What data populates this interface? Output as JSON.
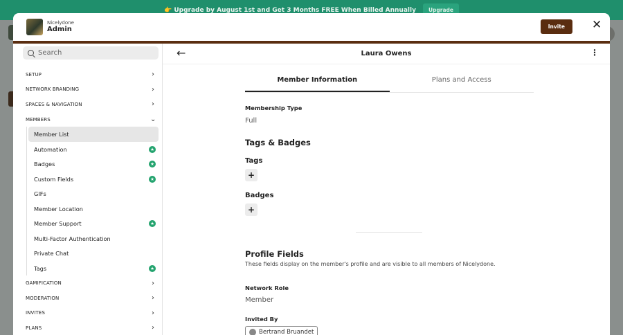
{
  "banner": {
    "text": "👉 Upgrade by August 1st and Get 3 Months FREE When Billed Annually",
    "button": "Upgrade"
  },
  "modal": {
    "org_name": "Nicelydone",
    "role": "Admin",
    "invite_label": "Invite",
    "close_icon": "close-icon"
  },
  "sidebar": {
    "search_placeholder": "Search",
    "sections_top": [
      {
        "label": "SETUP"
      },
      {
        "label": "NETWORK BRANDING"
      },
      {
        "label": "SPACES & NAVIGATION"
      }
    ],
    "members_label": "MEMBERS",
    "members_items": [
      {
        "label": "Member List",
        "badge": false,
        "active": true
      },
      {
        "label": "Automation",
        "badge": true
      },
      {
        "label": "Badges",
        "badge": true
      },
      {
        "label": "Custom Fields",
        "badge": true
      },
      {
        "label": "GIFs",
        "badge": false
      },
      {
        "label": "Member Location",
        "badge": false
      },
      {
        "label": "Member Support",
        "badge": true
      },
      {
        "label": "Multi-Factor Authentication",
        "badge": false
      },
      {
        "label": "Private Chat",
        "badge": false
      },
      {
        "label": "Tags",
        "badge": true
      }
    ],
    "sections_bottom": [
      {
        "label": "GAMIFICATION"
      },
      {
        "label": "MODERATION"
      },
      {
        "label": "INVITES"
      },
      {
        "label": "PLANS"
      }
    ]
  },
  "member": {
    "name": "Laura Owens",
    "tabs": [
      {
        "label": "Member Information",
        "active": true
      },
      {
        "label": "Plans and Access",
        "active": false
      }
    ],
    "membership_type_label": "Membership Type",
    "membership_type": "Full",
    "tags_badges_heading": "Tags & Badges",
    "tags_label": "Tags",
    "badges_label": "Badges",
    "add_symbol": "+",
    "profile_fields_heading": "Profile Fields",
    "profile_fields_desc": "These fields display on the member's profile and are visible to all members of Nicelydone.",
    "network_role_label": "Network Role",
    "network_role": "Member",
    "invited_by_label": "Invited By",
    "invited_by": "Bertrand Bruandet"
  },
  "colors": {
    "banner": "#1f8f6c",
    "accent_brown": "#5a2d10",
    "badge_green": "#23a36e"
  }
}
